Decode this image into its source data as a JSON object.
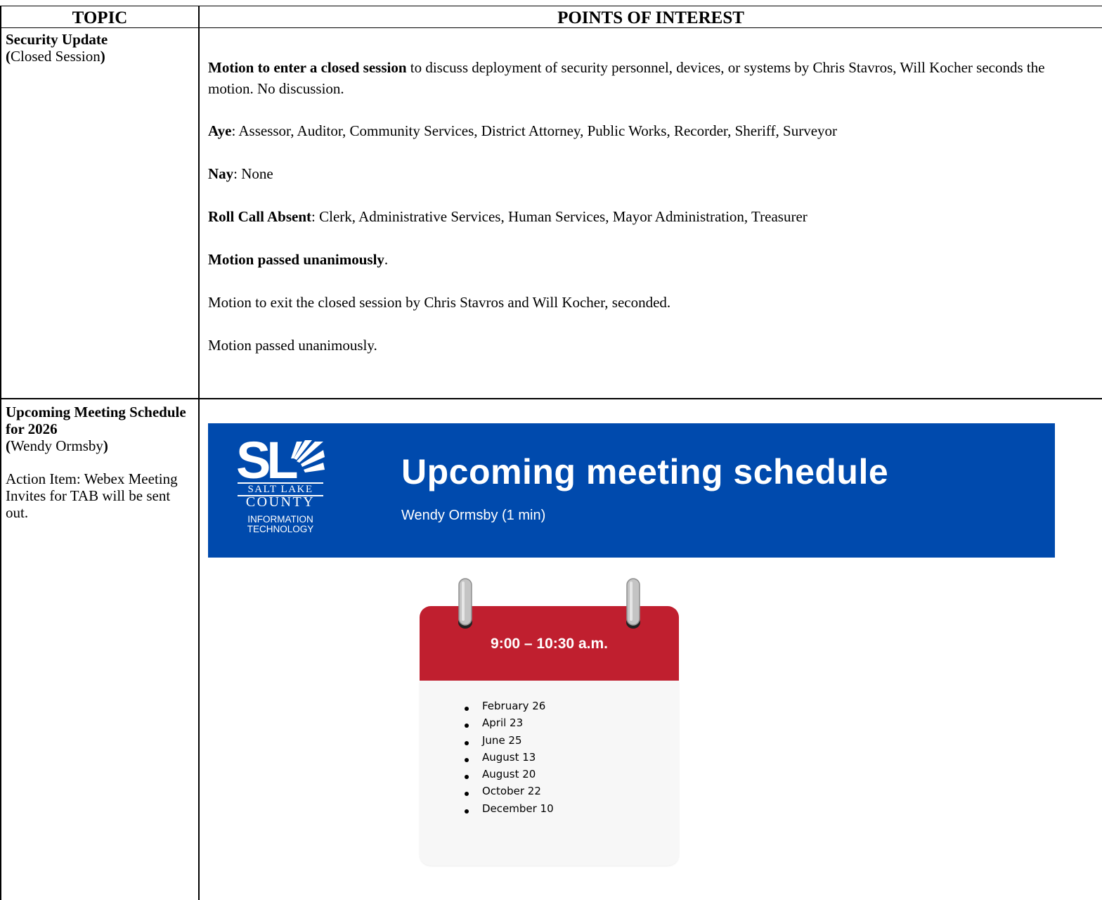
{
  "table": {
    "headers": {
      "topic": "TOPIC",
      "points": "POINTS OF INTEREST"
    }
  },
  "rows": [
    {
      "topic_title": "Security Update",
      "topic_sub_open": "(",
      "topic_sub": "Closed Session",
      "topic_sub_close": ")",
      "motion_bold": "Motion to enter a closed session",
      "motion_rest": " to discuss deployment of security personnel, devices, or systems by Chris Stavros, Will Kocher seconds the motion. No discussion.",
      "aye_label": "Aye",
      "aye_text": ":  Assessor, Auditor, Community Services, District Attorney, Public Works, Recorder, Sheriff, Surveyor",
      "nay_label": "Nay",
      "nay_text": ":  None",
      "absent_label": "Roll Call Absent",
      "absent_text": ": Clerk, Administrative Services, Human Services, Mayor Administration, Treasurer",
      "passed_bold": "Motion passed unanimously",
      "passed_end": ".",
      "exit_text": "Motion to exit the closed session by Chris Stavros and Will Kocher, seconded.",
      "passed2_text": "Motion passed unanimously."
    },
    {
      "topic_title": "Upcoming Meeting Schedule for 2026",
      "topic_sub_open": "(",
      "topic_sub": "Wendy Ormsby",
      "topic_sub_close": ")",
      "action_text": "Action Item:  Webex Meeting Invites for TAB will be sent out."
    }
  ],
  "slide": {
    "logo": {
      "mark": "SL",
      "salt_lake": "SALT LAKE",
      "county": "COUNTY",
      "info1": "INFORMATION",
      "info2": "TECHNOLOGY"
    },
    "title": "Upcoming meeting schedule",
    "subtitle": "Wendy Ormsby (1 min)",
    "colors": {
      "banner": "#004aad",
      "calendar_top": "#c01f2f",
      "calendar_body": "#f7f7f7"
    },
    "calendar": {
      "time": "9:00 – 10:30 a.m.",
      "dates": [
        "February 26",
        "April 23",
        "June 25",
        "August 13",
        "August 20",
        "October 22",
        "December 10"
      ]
    }
  }
}
